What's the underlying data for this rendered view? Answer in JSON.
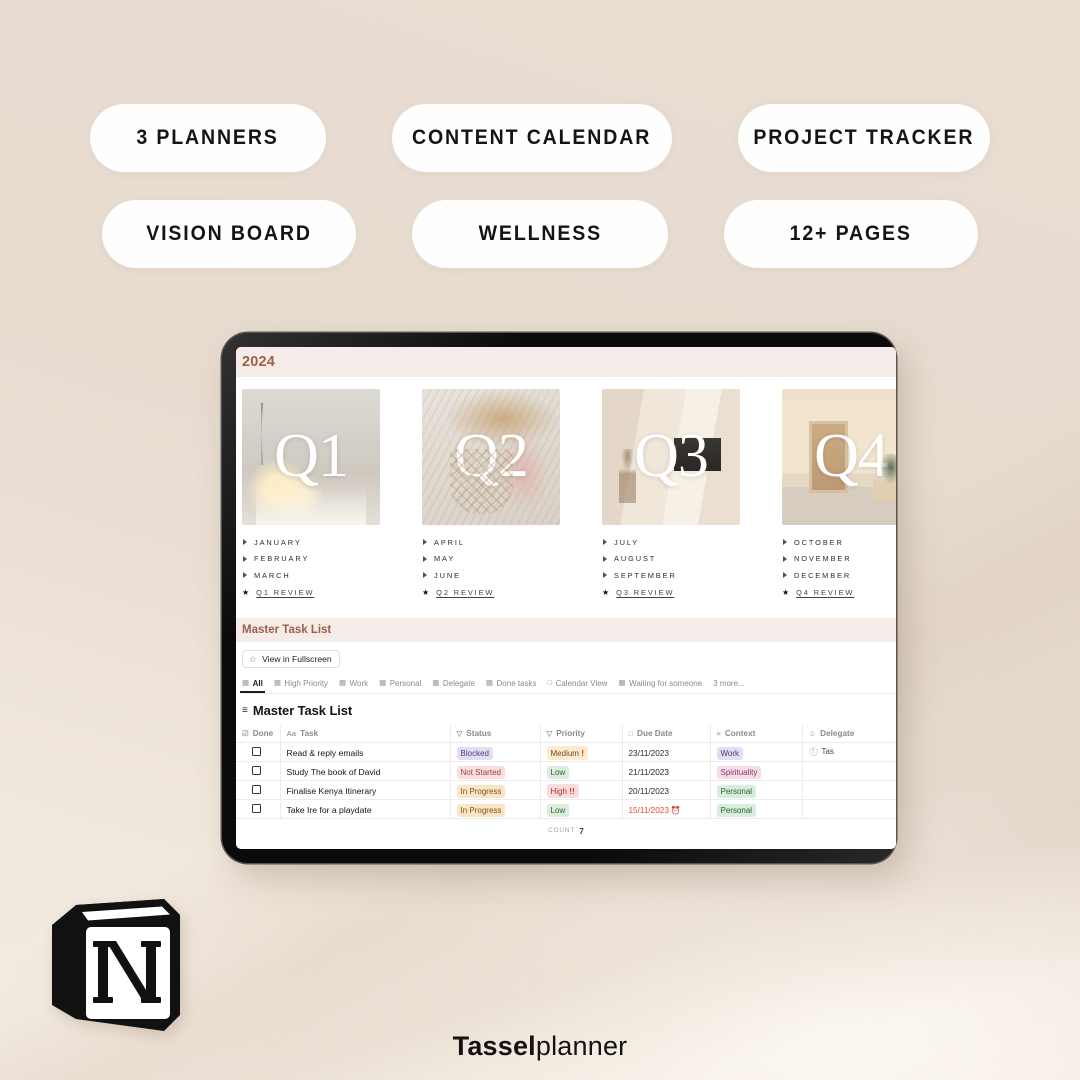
{
  "background_color": "#e7dbd0",
  "features": {
    "row1": [
      {
        "label": "3 PLANNERS"
      },
      {
        "label": "CONTENT CALENDAR"
      },
      {
        "label": "PROJECT TRACKER"
      }
    ],
    "row2": [
      {
        "label": "VISION BOARD"
      },
      {
        "label": "WELLNESS"
      },
      {
        "label": "12+ PAGES"
      }
    ]
  },
  "tablet": {
    "page": {
      "year_band": {
        "title": "2024",
        "text_color": "#9d6048",
        "band_color": "#f5ece9"
      },
      "quarters": [
        {
          "label": "Q1",
          "months": [
            "JANUARY",
            "FEBRUARY",
            "MARCH"
          ],
          "review": "Q1 REVIEW"
        },
        {
          "label": "Q2",
          "months": [
            "APRIL",
            "MAY",
            "JUNE"
          ],
          "review": "Q2 REVIEW"
        },
        {
          "label": "Q3",
          "months": [
            "JULY",
            "AUGUST",
            "SEPTEMBER"
          ],
          "review": "Q3 REVIEW"
        },
        {
          "label": "Q4",
          "months": [
            "OCTOBER",
            "NOVEMBER",
            "DECEMBER"
          ],
          "review": "Q4 REVIEW"
        }
      ],
      "master_task_list": {
        "band_title": "Master Task List",
        "fullscreen_button": {
          "label": "View in Fullscreen",
          "icon": "star-icon"
        },
        "view_tabs": [
          {
            "label": "All",
            "icon": "table-icon",
            "active": true
          },
          {
            "label": "High Priority",
            "icon": "table-icon",
            "active": false
          },
          {
            "label": "Work",
            "icon": "table-icon",
            "active": false
          },
          {
            "label": "Personal",
            "icon": "table-icon",
            "active": false
          },
          {
            "label": "Delegate",
            "icon": "table-icon",
            "active": false
          },
          {
            "label": "Done tasks",
            "icon": "table-icon",
            "active": false
          },
          {
            "label": "Calendar View",
            "icon": "calendar-icon",
            "active": false
          },
          {
            "label": "Waiting for someone",
            "icon": "table-icon",
            "active": false
          }
        ],
        "more_tabs_label": "3 more...",
        "database_title": "Master Task List",
        "database_icon": "list-icon",
        "columns": [
          {
            "label": "Done",
            "icon": "checkbox-icon"
          },
          {
            "label": "Task",
            "icon": "text-icon"
          },
          {
            "label": "Status",
            "icon": "select-icon"
          },
          {
            "label": "Priority",
            "icon": "select-icon"
          },
          {
            "label": "Due Date",
            "icon": "calendar-icon"
          },
          {
            "label": "Context",
            "icon": "multiselect-icon"
          },
          {
            "label": "Delegate",
            "icon": "person-icon"
          }
        ],
        "rows": [
          {
            "done": false,
            "task": "Read & reply emails",
            "status": "Blocked",
            "status_class": "b-blocked",
            "priority": "Medium",
            "priority_class": "b-medium",
            "priority_bangs": "!",
            "due_date": "23/11/2023",
            "overdue": false,
            "context": "Work",
            "context_class": "b-work",
            "delegate": "Tas"
          },
          {
            "done": false,
            "task": "Study The book of David",
            "status": "Not Started",
            "status_class": "b-notstart",
            "priority": "Low",
            "priority_class": "b-low",
            "priority_bangs": "",
            "due_date": "21/11/2023",
            "overdue": false,
            "context": "Spirituality",
            "context_class": "b-spirit",
            "delegate": ""
          },
          {
            "done": false,
            "task": "Finalise Kenya Itinerary",
            "status": "In Progress",
            "status_class": "b-inprog",
            "priority": "High",
            "priority_class": "b-high",
            "priority_bangs": "!!",
            "due_date": "20/11/2023",
            "overdue": false,
            "context": "Personal",
            "context_class": "b-personal",
            "delegate": ""
          },
          {
            "done": false,
            "task": "Take Ire for a playdate",
            "status": "In Progress",
            "status_class": "b-inprog",
            "priority": "Low",
            "priority_class": "b-low",
            "priority_bangs": "",
            "due_date": "15/11/2023",
            "overdue": true,
            "context": "Personal",
            "context_class": "b-personal",
            "delegate": ""
          }
        ],
        "count_label": "COUNT",
        "count_value": "7"
      }
    }
  },
  "logo": {
    "name": "notion-logo",
    "letter": "N"
  },
  "brand": {
    "bold": "Tassel",
    "light": "planner"
  }
}
